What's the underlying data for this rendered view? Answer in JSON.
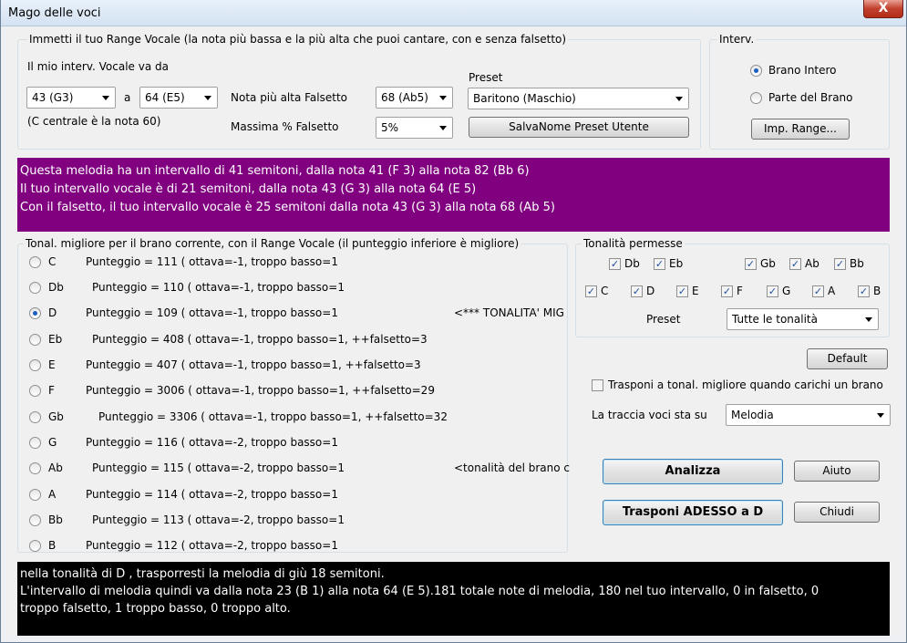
{
  "window": {
    "title": "Mago delle voci",
    "close_glyph": "X"
  },
  "range_group": {
    "legend": "Immetti il tuo Range Vocale (la nota più bassa e la più alta che puoi cantare, con e senza falsetto)",
    "range_label": "Il mio interv. Vocale va da",
    "low_note": "43 (G3)",
    "to_label": "a",
    "high_note": "64 (E5)",
    "middle_c_note": "(C centrale è la nota 60)",
    "falsetto_high_label": "Nota più alta Falsetto",
    "falsetto_high_value": "68 (Ab5)",
    "falsetto_max_label": "Massima % Falsetto",
    "falsetto_max_value": "5%",
    "preset_label": "Preset",
    "preset_value": "Baritono (Maschio)",
    "save_preset_button": "SalvaNome Preset Utente"
  },
  "interval_group": {
    "legend": "Interv.",
    "whole_song": "Brano Intero",
    "part_song": "Parte del Brano",
    "set_range_button": "Imp. Range..."
  },
  "info": {
    "line1": "Questa melodia ha un intervallo di 41 semitoni, dalla nota 41 (F  3)  alla nota 82 (Bb 6)",
    "line2": "Il tuo intervallo vocale è di 21 semitoni, dalla nota 43 (G  3) alla nota 64 (E  5)",
    "line3": "Con il falsetto, il tuo intervallo vocale è 25 semitoni dalla nota 43 (G  3) alla nota 68 (Ab 5)"
  },
  "keys_group": {
    "legend": "Tonal. migliore per il brano corrente, con il Range Vocale (il punteggio inferiore è migliore)",
    "rows": [
      {
        "key": "C",
        "desc": "Punteggio =   111  (  ottava=-1,  troppo basso=1",
        "note": "",
        "selected": false
      },
      {
        "key": "Db",
        "desc": "Punteggio =   110  (  ottava=-1,  troppo basso=1",
        "note": "",
        "selected": false
      },
      {
        "key": "D",
        "desc": "Punteggio =   109  (  ottava=-1,  troppo basso=1",
        "note": "<*** TONALITA' MIG",
        "selected": true
      },
      {
        "key": "Eb",
        "desc": "Punteggio =   408  (  ottava=-1,  troppo basso=1,  ++falsetto=3",
        "note": "",
        "selected": false
      },
      {
        "key": "E",
        "desc": "Punteggio =   407  (  ottava=-1,  troppo basso=1,  ++falsetto=3",
        "note": "",
        "selected": false
      },
      {
        "key": "F",
        "desc": "Punteggio =   3006  (  ottava=-1,  troppo basso=1,  ++falsetto=29",
        "note": "",
        "selected": false
      },
      {
        "key": "Gb",
        "desc": "Punteggio =   3306  (  ottava=-1,  troppo basso=1,  ++falsetto=32",
        "note": "",
        "selected": false
      },
      {
        "key": "G",
        "desc": "Punteggio =   116  (  ottava=-2,  troppo basso=1",
        "note": "",
        "selected": false
      },
      {
        "key": "Ab",
        "desc": "Punteggio =   115  (  ottava=-2,  troppo basso=1",
        "note": "<tonalità del brano c",
        "selected": false
      },
      {
        "key": "A",
        "desc": "Punteggio =   114  (  ottava=-2,  troppo basso=1",
        "note": "",
        "selected": false
      },
      {
        "key": "Bb",
        "desc": "Punteggio =   113  (  ottava=-2,  troppo basso=1",
        "note": "",
        "selected": false
      },
      {
        "key": "B",
        "desc": "Punteggio =   112  (  ottava=-2,  troppo basso=1",
        "note": "",
        "selected": false
      }
    ]
  },
  "allowed_group": {
    "legend": "Tonalità permesse",
    "flats": [
      "Db",
      "Eb",
      "Gb",
      "Ab",
      "Bb"
    ],
    "naturals": [
      "C",
      "D",
      "E",
      "F",
      "G",
      "A",
      "B"
    ],
    "preset_label": "Preset",
    "preset_value": "Tutte le tonalità"
  },
  "controls": {
    "default_button": "Default",
    "transpose_on_load": "Trasponi a tonal. migliore quando carichi un brano",
    "voice_track_label": "La traccia voci sta su",
    "voice_track_value": "Melodia",
    "analyze_button": "Analizza",
    "help_button": "Aiuto",
    "transpose_button": "Trasponi ADESSO a D",
    "close_button": "Chiudi"
  },
  "result": {
    "line1": "nella tonalità di D  , trasporresti la melodia di giù 18 semitoni.",
    "line2": "L'intervallo di melodia quindi va dalla nota 23 (B  1) alla nota 64 (E  5).181 totale note di melodia, 180 nel tuo intervallo, 0 in falsetto, 0",
    "line3": "troppo falsetto, 1 troppo basso, 0 troppo alto."
  }
}
